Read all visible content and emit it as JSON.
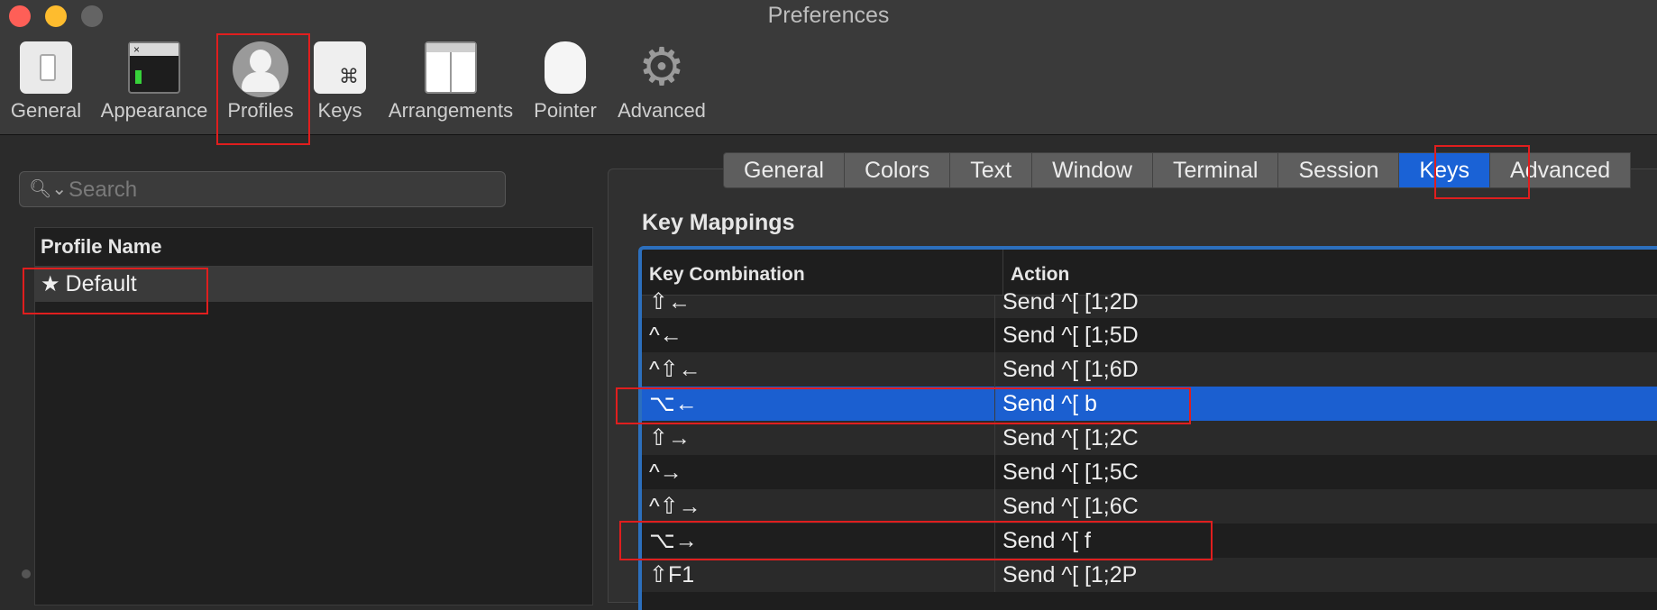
{
  "window": {
    "title": "Preferences"
  },
  "toolbar": {
    "items": [
      {
        "label": "General"
      },
      {
        "label": "Appearance"
      },
      {
        "label": "Profiles"
      },
      {
        "label": "Keys"
      },
      {
        "label": "Arrangements"
      },
      {
        "label": "Pointer"
      },
      {
        "label": "Advanced"
      }
    ],
    "selected": "Profiles"
  },
  "search": {
    "placeholder": "Search"
  },
  "profiles": {
    "header": "Profile Name",
    "items": [
      {
        "name": "Default",
        "starred": true
      }
    ]
  },
  "profile_tabs": {
    "items": [
      "General",
      "Colors",
      "Text",
      "Window",
      "Terminal",
      "Session",
      "Keys",
      "Advanced"
    ],
    "selected": "Keys"
  },
  "key_mappings": {
    "title": "Key Mappings",
    "columns": [
      "Key Combination",
      "Action"
    ],
    "rows": [
      {
        "key": "⇧←",
        "action": "Send ^[ [1;2D"
      },
      {
        "key": "^←",
        "action": "Send ^[ [1;5D"
      },
      {
        "key": "^⇧←",
        "action": "Send ^[ [1;6D"
      },
      {
        "key": "⌥←",
        "action": "Send ^[ b",
        "selected": true
      },
      {
        "key": "⇧→",
        "action": "Send ^[ [1;2C"
      },
      {
        "key": "^→",
        "action": "Send ^[ [1;5C"
      },
      {
        "key": "^⇧→",
        "action": "Send ^[ [1;6C"
      },
      {
        "key": "⌥→",
        "action": "Send ^[ f"
      },
      {
        "key": "⇧F1",
        "action": "Send ^[ [1;2P"
      }
    ]
  },
  "colors": {
    "accent": "#1a62d6",
    "highlight": "#e01e1e"
  }
}
